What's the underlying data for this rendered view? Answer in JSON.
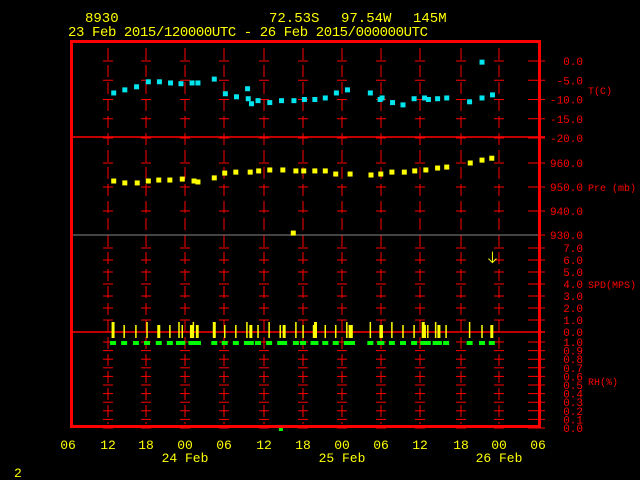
{
  "header": {
    "station": "8930",
    "latitude": "72.53S",
    "longitude": "97.54W",
    "elevation": "145M",
    "time_range": "23 Feb 2015/120000UTC - 26 Feb 2015/000000UTC"
  },
  "footer": {
    "frame_number": "2"
  },
  "colors": {
    "frame": "#ff0000",
    "text": "#ffff00",
    "temperature": "#00e5ee",
    "pressure": "#ffff00",
    "wind": "#ffff00",
    "rh": "#00ff00",
    "axis_labels": "#ff0000"
  },
  "chart_data": [
    {
      "type": "scatter",
      "ylabel": "T(C)",
      "ylim": [
        -20,
        0
      ],
      "ticks": [
        "0.0",
        "-5.0",
        "-10.0",
        "-15.0",
        "-20.0"
      ],
      "color": "#00e5ee",
      "points": [
        [
          "23 13:00",
          -8.3
        ],
        [
          "23 14:42",
          -7.5
        ],
        [
          "23 16:30",
          -6.7
        ],
        [
          "23 18:18",
          -5.4
        ],
        [
          "23 20:00",
          -5.4
        ],
        [
          "23 21:42",
          -5.7
        ],
        [
          "23 23:18",
          -5.9
        ],
        [
          "24 01:00",
          -5.7
        ],
        [
          "24 01:54",
          -5.7
        ],
        [
          "24 04:24",
          -4.7
        ],
        [
          "24 06:06",
          -8.5
        ],
        [
          "24 07:48",
          -9.3
        ],
        [
          "24 09:30",
          -7.2
        ],
        [
          "24 09:36",
          -9.8
        ],
        [
          "24 10:06",
          -11.1
        ],
        [
          "24 11:06",
          -10.3
        ],
        [
          "24 12:54",
          -10.8
        ],
        [
          "24 14:42",
          -10.3
        ],
        [
          "24 16:36",
          -10.3
        ],
        [
          "24 18:12",
          -10.0
        ],
        [
          "24 19:48",
          -10.0
        ],
        [
          "24 21:24",
          -9.6
        ],
        [
          "24 23:06",
          -8.3
        ],
        [
          "25 00:48",
          -7.5
        ],
        [
          "25 04:18",
          -8.3
        ],
        [
          "25 05:48",
          -10.0
        ],
        [
          "25 06:06",
          -9.6
        ],
        [
          "25 07:42",
          -10.8
        ],
        [
          "25 09:18",
          -11.4
        ],
        [
          "25 11:00",
          -9.8
        ],
        [
          "25 12:36",
          -9.6
        ],
        [
          "25 13:12",
          -10.0
        ],
        [
          "25 14:36",
          -9.8
        ],
        [
          "25 16:00",
          -9.6
        ],
        [
          "25 19:30",
          -10.6
        ],
        [
          "25 21:24",
          -9.6
        ],
        [
          "25 21:24",
          -0.3
        ],
        [
          "25 23:00",
          -8.8
        ]
      ]
    },
    {
      "type": "scatter",
      "ylabel": "Pre (mb)",
      "ylim": [
        930,
        960
      ],
      "ticks": [
        "960.0",
        "950.0",
        "940.0",
        "930.0"
      ],
      "color": "#ffff00",
      "points": [
        [
          "23 13:00",
          952.5
        ],
        [
          "23 14:42",
          951.7
        ],
        [
          "23 16:36",
          951.7
        ],
        [
          "23 18:18",
          952.5
        ],
        [
          "23 19:54",
          952.9
        ],
        [
          "23 21:36",
          952.9
        ],
        [
          "23 23:30",
          953.3
        ],
        [
          "24 01:18",
          952.5
        ],
        [
          "24 01:54",
          952.1
        ],
        [
          "24 04:24",
          953.8
        ],
        [
          "24 06:00",
          955.8
        ],
        [
          "24 07:42",
          956.2
        ],
        [
          "24 09:54",
          956.2
        ],
        [
          "24 11:12",
          956.7
        ],
        [
          "24 12:54",
          957.1
        ],
        [
          "24 14:54",
          957.1
        ],
        [
          "24 16:30",
          930.8
        ],
        [
          "24 16:54",
          956.7
        ],
        [
          "24 18:06",
          956.7
        ],
        [
          "24 19:48",
          956.7
        ],
        [
          "24 21:24",
          956.7
        ],
        [
          "24 23:00",
          955.4
        ],
        [
          "25 01:12",
          955.4
        ],
        [
          "25 04:24",
          955.0
        ],
        [
          "25 05:54",
          955.4
        ],
        [
          "25 07:36",
          956.2
        ],
        [
          "25 09:30",
          956.2
        ],
        [
          "25 11:06",
          956.7
        ],
        [
          "25 12:48",
          957.1
        ],
        [
          "25 14:36",
          957.9
        ],
        [
          "25 16:00",
          958.3
        ],
        [
          "25 19:36",
          960.0
        ],
        [
          "25 21:24",
          961.2
        ],
        [
          "25 22:54",
          962.0
        ]
      ]
    },
    {
      "type": "scatter",
      "ylabel": "SPD(MPS)",
      "ylim": [
        0,
        7
      ],
      "ticks": [
        "7.0",
        "6.0",
        "5.0",
        "4.0",
        "3.0",
        "2.0",
        "1.0",
        "0.0"
      ],
      "color": "#ffff00",
      "times": [
        "23 12:54",
        "23 14:36",
        "23 16:24",
        "23 18:06",
        "23 19:54",
        "23 21:36",
        "23 23:00",
        "23 23:30",
        "24 00:54",
        "24 01:12",
        "24 01:42",
        "24 01:54",
        "24 04:24",
        "24 06:00",
        "24 07:42",
        "24 09:24",
        "24 10:00",
        "24 11:06",
        "24 12:48",
        "24 14:30",
        "24 15:06",
        "24 16:54",
        "24 18:00",
        "24 19:36",
        "24 19:54",
        "24 21:24",
        "24 23:00",
        "25 00:42",
        "25 01:12",
        "25 01:30",
        "25 04:18",
        "25 05:48",
        "25 06:00",
        "25 07:36",
        "25 09:18",
        "25 11:00",
        "25 12:24",
        "25 12:42",
        "25 13:06",
        "25 14:18",
        "25 14:48",
        "25 15:54",
        "25 19:30",
        "25 21:24",
        "25 22:54"
      ],
      "values": 0.0,
      "direction_arrow": {
        "time": "25 23:00",
        "speed": 6.2,
        "direction": "down"
      }
    },
    {
      "type": "scatter",
      "ylabel": "RH(%)",
      "ylim": [
        0,
        1.0
      ],
      "ticks": [
        "1.0",
        "0.9",
        "0.8",
        "0.7",
        "0.6",
        "0.5",
        "0.4",
        "0.3",
        "0.2",
        "0.1",
        "0.0"
      ],
      "color": "#00ff00",
      "value": 1.0,
      "outlier": {
        "time": "24 14:36",
        "value": 0.0
      }
    }
  ],
  "x_axis": {
    "ticks": [
      "06",
      "12",
      "18",
      "00",
      "06",
      "12",
      "18",
      "00",
      "06",
      "12",
      "18",
      "00",
      "06"
    ],
    "dates": [
      {
        "label": "24 Feb",
        "tick": 3
      },
      {
        "label": "25 Feb",
        "tick": 7
      },
      {
        "label": "26 Feb",
        "tick": 11
      }
    ]
  }
}
